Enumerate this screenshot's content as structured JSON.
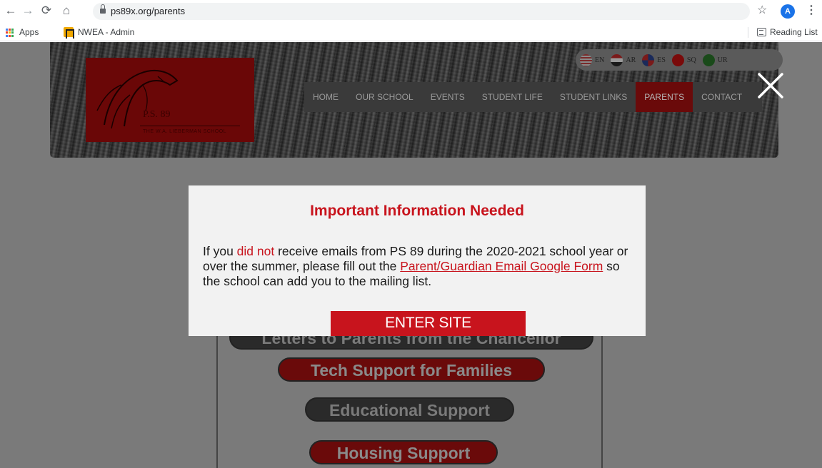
{
  "browser": {
    "url": "ps89x.org/parents",
    "profile_initial": "A",
    "bookmarks": [
      {
        "label": "Apps"
      },
      {
        "label": "NWEA - Admin"
      }
    ],
    "reading_list_label": "Reading List"
  },
  "site": {
    "logo_name": "P.S. 89",
    "logo_subtitle": "THE W.A. LIEBERMAN SCHOOL",
    "languages": [
      {
        "code": "EN",
        "flag": "us-flag-icon"
      },
      {
        "code": "AR",
        "flag": "egypt-flag-icon"
      },
      {
        "code": "ES",
        "flag": "dominican-flag-icon"
      },
      {
        "code": "SQ",
        "flag": "albania-flag-icon"
      },
      {
        "code": "UR",
        "flag": "pakistan-flag-icon"
      }
    ],
    "nav": [
      {
        "label": "HOME"
      },
      {
        "label": "OUR SCHOOL"
      },
      {
        "label": "EVENTS"
      },
      {
        "label": "STUDENT LIFE"
      },
      {
        "label": "STUDENT LINKS"
      },
      {
        "label": "PARENTS",
        "active": true
      },
      {
        "label": "CONTACT"
      }
    ],
    "page_buttons": [
      {
        "label": "Letters to Parents from the Chancellor",
        "style": "black"
      },
      {
        "label": "Tech Support for Families",
        "style": "red"
      },
      {
        "label": "Educational Support",
        "style": "black"
      },
      {
        "label": "Housing Support",
        "style": "red"
      }
    ]
  },
  "modal": {
    "title": "Important Information Needed",
    "body_1": "If you ",
    "body_highlight": "did not",
    "body_2": " receive emails from PS 89 during the 2020-2021 school year or over the summer, please fill out the ",
    "link_text": "Parent/Guardian Email Google Form",
    "body_3": " so the school can add you to the mailing list.",
    "button_label": "ENTER SITE"
  },
  "colors": {
    "accent_red": "#c8141d",
    "overlay_gray": "#7a7a7a",
    "modal_bg": "#f2f2f2"
  }
}
